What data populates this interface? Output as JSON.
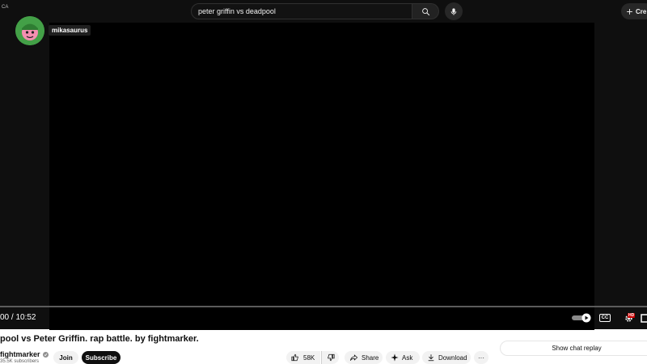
{
  "header": {
    "corner_text": "CA",
    "search_value": "peter griffin vs deadpool",
    "create_label": "Cre"
  },
  "overlay": {
    "channel_tag": "mikasaurus"
  },
  "player": {
    "time": "00 / 10:52",
    "progress_fraction": 0.0,
    "cc_label": "CC",
    "hd_badge": "HD"
  },
  "video": {
    "title": "pool vs Peter Griffin. rap battle. by fightmarker.",
    "channel": "fightmarker",
    "subscribers": "35.5K subscribers",
    "join_label": "Join",
    "subscribe_label": "Subscribe",
    "like_count": "58K",
    "share_label": "Share",
    "ask_label": "Ask",
    "download_label": "Download",
    "more_label": "···"
  },
  "chat": {
    "show_replay_label": "Show chat replay"
  },
  "colors": {
    "dark_bg": "#0f0f0f",
    "video_bg": "#000000",
    "progress": "#ff0000",
    "avatar_green": "#43a047"
  }
}
